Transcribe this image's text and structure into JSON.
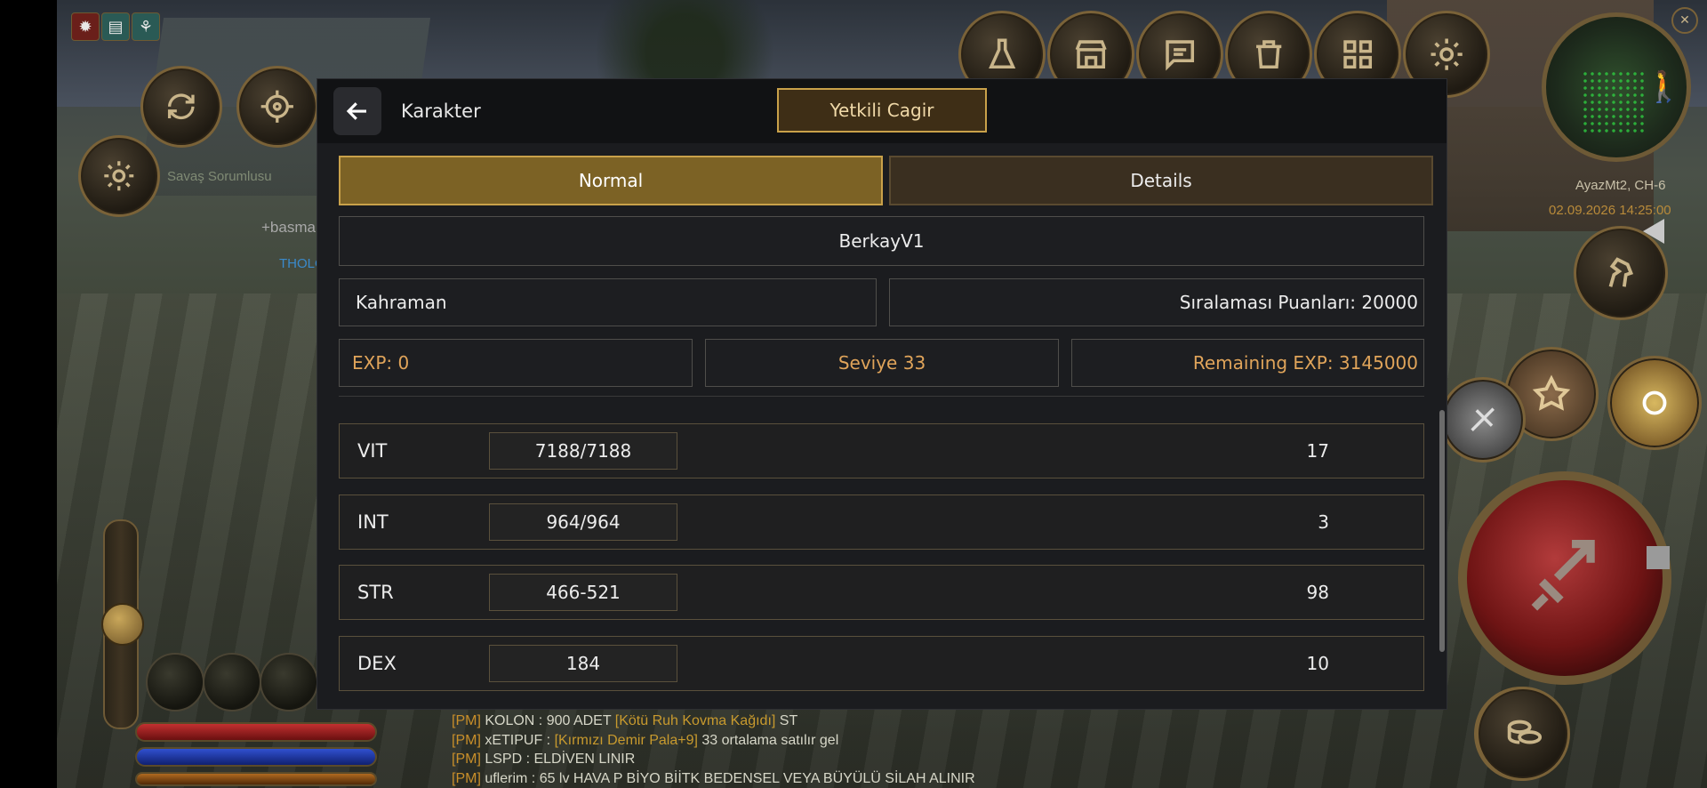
{
  "dialog": {
    "title": "Karakter",
    "gm_button": "Yetkili Cagir",
    "tabs": [
      {
        "label": "Normal",
        "active": true
      },
      {
        "label": "Details",
        "active": false
      }
    ],
    "character_name": "BerkayV1",
    "class_name": "Kahraman",
    "rank_points": "Sıralaması Puanları: 20000",
    "exp": "EXP: 0",
    "level": "Seviye 33",
    "remaining_exp": "Remaining EXP: 3145000",
    "stats": [
      {
        "name": "VIT",
        "value": "7188/7188",
        "points": "17"
      },
      {
        "name": "INT",
        "value": "964/964",
        "points": "3"
      },
      {
        "name": "STR",
        "value": "466-521",
        "points": "98"
      },
      {
        "name": "DEX",
        "value": "184",
        "points": "10"
      }
    ]
  },
  "hud": {
    "top_icons": [
      "flask-icon",
      "shop-icon",
      "chat-icon",
      "trash-icon",
      "grid-icon",
      "gear-icon"
    ],
    "map_server": "AyazMt2, CH-6",
    "map_datetime": "02.09.2026 14:25:00",
    "npc_label": "Savaş Sorumlusu",
    "ghost_text_1": "+basma",
    "ghost_text_2": "THOLO"
  },
  "chat": [
    {
      "tag": "[PM]",
      "sender": "KOLON :",
      "text": "900 ADET",
      "item": "[Kötü Ruh Kovma Kağıdı]",
      "tail": "ST"
    },
    {
      "tag": "[PM]",
      "sender": "xETIPUF :",
      "text": "",
      "item": "[Kırmızı Demir Pala+9]",
      "tail": "33 ortalama satılır gel"
    },
    {
      "tag": "[PM]",
      "sender": "LSPD :",
      "text": "ELDİVEN LINIR",
      "item": "",
      "tail": ""
    },
    {
      "tag": "[PM]",
      "sender": "uflerim :",
      "text": "65 lv HAVA P BİYO BİİTK BEDENSEL VEYA BÜYÜLÜ SİLAH ALINIR",
      "item": "",
      "tail": ""
    }
  ],
  "colors": {
    "accent_gold": "#c9a14a",
    "tab_active": "#7c6225",
    "exp_text": "#e0a45a",
    "dialog_bg": "#1b1c1f"
  }
}
